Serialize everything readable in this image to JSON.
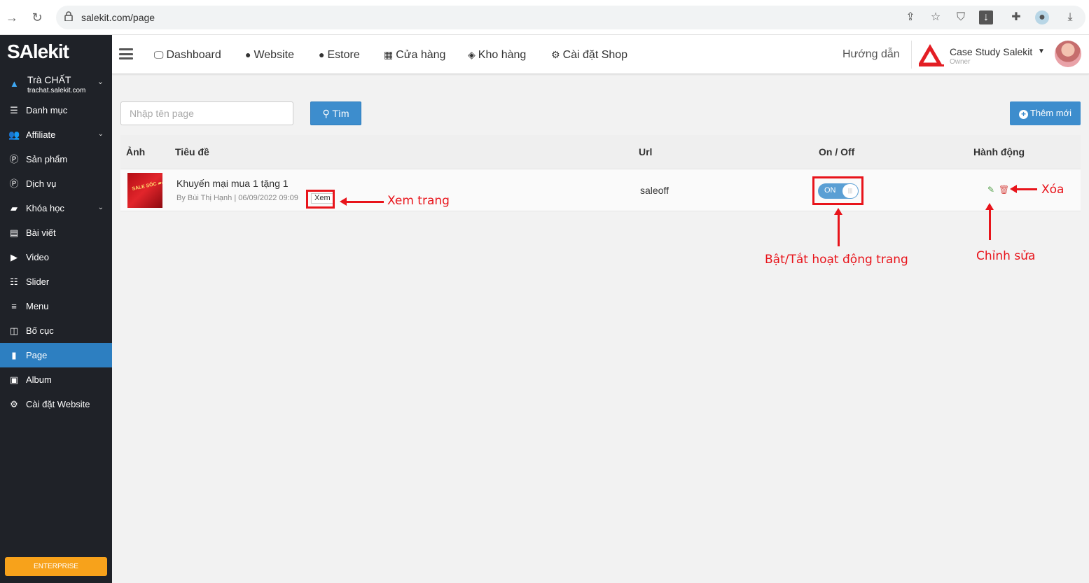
{
  "browser": {
    "url": "salekit.com/page"
  },
  "sidebar": {
    "logo": "SAlekit",
    "shop_name": "Trà CHẤT",
    "shop_domain": "trachat.salekit.com",
    "items": [
      {
        "label": "Danh mục",
        "icon": "list-icon",
        "has_sub": false
      },
      {
        "label": "Affiliate",
        "icon": "users-icon",
        "has_sub": true
      },
      {
        "label": "Sản phẩm",
        "icon": "product-icon",
        "has_sub": false
      },
      {
        "label": "Dịch vụ",
        "icon": "service-icon",
        "has_sub": false
      },
      {
        "label": "Khóa học",
        "icon": "book-icon",
        "has_sub": true
      },
      {
        "label": "Bài viết",
        "icon": "newspaper-icon",
        "has_sub": false
      },
      {
        "label": "Video",
        "icon": "video-icon",
        "has_sub": false
      },
      {
        "label": "Slider",
        "icon": "sliders-icon",
        "has_sub": false
      },
      {
        "label": "Menu",
        "icon": "menu-icon",
        "has_sub": false
      },
      {
        "label": "Bố cục",
        "icon": "layout-icon",
        "has_sub": false
      },
      {
        "label": "Page",
        "icon": "file-icon",
        "has_sub": false,
        "active": true
      },
      {
        "label": "Album",
        "icon": "image-icon",
        "has_sub": false
      },
      {
        "label": "Cài đặt Website",
        "icon": "gear-icon",
        "has_sub": false
      }
    ],
    "plan_badge": "ENTERPRISE"
  },
  "topnav": {
    "items": [
      {
        "label": "Dashboard",
        "icon": "monitor-icon"
      },
      {
        "label": "Website",
        "icon": "globe-icon"
      },
      {
        "label": "Estore",
        "icon": "globe-icon"
      },
      {
        "label": "Cửa hàng",
        "icon": "store-icon"
      },
      {
        "label": "Kho hàng",
        "icon": "stack-icon"
      },
      {
        "label": "Cài đặt Shop",
        "icon": "gear-icon"
      }
    ],
    "guide": "Hướng dẫn",
    "account_name": "Case Study Salekit",
    "account_role": "Owner"
  },
  "main": {
    "search_placeholder": "Nhập tên page",
    "search_button": "Tìm",
    "add_button": "Thêm mới",
    "table": {
      "headers": [
        "Ảnh",
        "Tiêu đề",
        "Url",
        "On / Off",
        "Hành động"
      ],
      "rows": [
        {
          "title": "Khuyến mại mua 1 tặng 1",
          "meta": "By Bùi Thị Hạnh | 06/09/2022 09:09",
          "view": "Xem",
          "url": "saleoff",
          "toggle": "ON"
        }
      ]
    }
  },
  "annotations": {
    "view": "Xem trang",
    "toggle": "Bật/Tắt hoạt động trang",
    "edit": "Chỉnh sửa",
    "delete": "Xóa",
    "color": "#e8141b"
  }
}
